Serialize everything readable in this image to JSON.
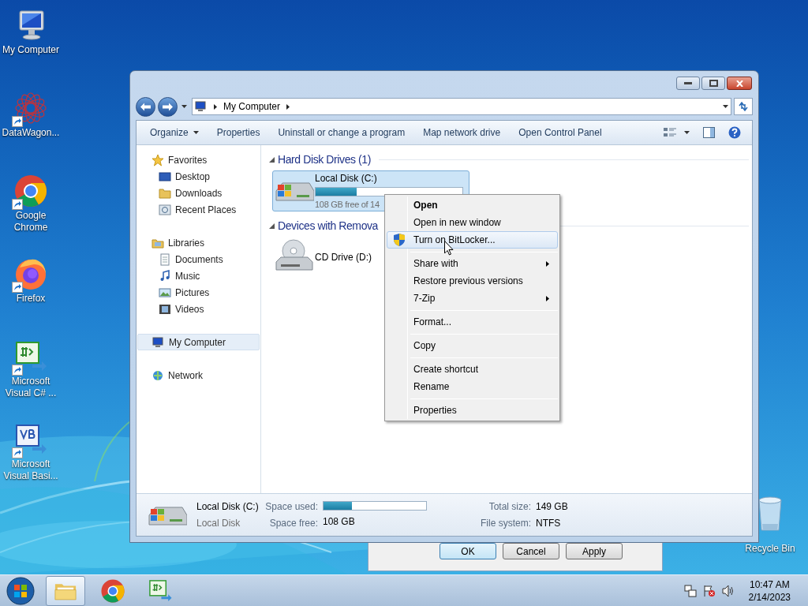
{
  "desktop_icons": [
    {
      "label": "My Computer",
      "kind": "computer",
      "shortcut": false
    },
    {
      "label": "DataWagon...",
      "kind": "star",
      "shortcut": true
    },
    {
      "label": "Google Chrome",
      "kind": "chrome",
      "shortcut": true
    },
    {
      "label": "Firefox",
      "kind": "firefox",
      "shortcut": true
    },
    {
      "label": "Microsoft Visual C# ...",
      "kind": "csharp",
      "shortcut": true
    },
    {
      "label": "Microsoft Visual Basi...",
      "kind": "vb",
      "shortcut": true
    }
  ],
  "recycle_bin": {
    "label": "Recycle Bin"
  },
  "back_dialog": {
    "buttons": [
      {
        "label": "OK",
        "default": true
      },
      {
        "label": "Cancel",
        "default": false
      },
      {
        "label": "Apply",
        "default": false
      }
    ]
  },
  "explorer": {
    "address": {
      "crumbs": [
        "My Computer"
      ]
    },
    "toolbar": [
      {
        "label": "Organize",
        "dropdown": true
      },
      {
        "label": "Properties",
        "dropdown": false
      },
      {
        "label": "Uninstall or change a program",
        "dropdown": false
      },
      {
        "label": "Map network drive",
        "dropdown": false
      },
      {
        "label": "Open Control Panel",
        "dropdown": false
      }
    ],
    "nav": [
      {
        "label": "Favorites",
        "kind": "star",
        "selected": false,
        "children": [
          {
            "label": "Desktop",
            "kind": "desktop",
            "selected": false
          },
          {
            "label": "Downloads",
            "kind": "folder",
            "selected": false
          },
          {
            "label": "Recent Places",
            "kind": "recent",
            "selected": false
          }
        ]
      },
      {
        "label": "Libraries",
        "kind": "library",
        "selected": false,
        "children": [
          {
            "label": "Documents",
            "kind": "document",
            "selected": false
          },
          {
            "label": "Music",
            "kind": "music",
            "selected": false
          },
          {
            "label": "Pictures",
            "kind": "pictures",
            "selected": false
          },
          {
            "label": "Videos",
            "kind": "video",
            "selected": false
          }
        ]
      },
      {
        "label": "My Computer",
        "kind": "computer",
        "selected": true
      },
      {
        "label": "Network",
        "kind": "network",
        "selected": false
      }
    ],
    "sections": [
      {
        "title": "Hard Disk Drives (1)",
        "expanded": true,
        "items": [
          {
            "name": "Local Disk (C:)",
            "kind": "hdd",
            "selected": true,
            "level": 0.28,
            "free": "108 GB free of 14"
          }
        ]
      },
      {
        "title": "Devices with Remova",
        "expanded": true,
        "items": [
          {
            "name": "CD Drive (D:)",
            "kind": "cd",
            "selected": false
          }
        ]
      }
    ],
    "details": {
      "name": "Local Disk (C:)",
      "type": "Local Disk",
      "used_label": "Space used:",
      "level": 0.28,
      "free_label": "Space free:",
      "free": "108 GB",
      "total_label": "Total size:",
      "total": "149 GB",
      "fs_label": "File system:",
      "fs": "NTFS"
    }
  },
  "context_menu": [
    {
      "kind": "item",
      "label": "Open",
      "bold": true,
      "shield": false,
      "submenu": false,
      "selected": false
    },
    {
      "kind": "item",
      "label": "Open in new window",
      "bold": false,
      "shield": false,
      "submenu": false,
      "selected": false
    },
    {
      "kind": "item",
      "label": "Turn on BitLocker...",
      "bold": false,
      "shield": true,
      "submenu": false,
      "selected": true
    },
    {
      "kind": "separator"
    },
    {
      "kind": "item",
      "label": "Share with",
      "bold": false,
      "shield": false,
      "submenu": true,
      "selected": false
    },
    {
      "kind": "item",
      "label": "Restore previous versions",
      "bold": false,
      "shield": false,
      "submenu": false,
      "selected": false
    },
    {
      "kind": "item",
      "label": "7-Zip",
      "bold": false,
      "shield": false,
      "submenu": true,
      "selected": false
    },
    {
      "kind": "separator"
    },
    {
      "kind": "item",
      "label": "Format...",
      "bold": false,
      "shield": false,
      "submenu": false,
      "selected": false
    },
    {
      "kind": "separator"
    },
    {
      "kind": "item",
      "label": "Copy",
      "bold": false,
      "shield": false,
      "submenu": false,
      "selected": false
    },
    {
      "kind": "separator"
    },
    {
      "kind": "item",
      "label": "Create shortcut",
      "bold": false,
      "shield": false,
      "submenu": false,
      "selected": false
    },
    {
      "kind": "item",
      "label": "Rename",
      "bold": false,
      "shield": false,
      "submenu": false,
      "selected": false
    },
    {
      "kind": "separator"
    },
    {
      "kind": "item",
      "label": "Properties",
      "bold": false,
      "shield": false,
      "submenu": false,
      "selected": false
    }
  ],
  "taskbar": {
    "items": [
      {
        "kind": "explorer",
        "active": true
      },
      {
        "kind": "chrome",
        "active": false
      },
      {
        "kind": "csharp",
        "active": false
      }
    ],
    "time": "10:47 AM",
    "date": "2/14/2023"
  }
}
